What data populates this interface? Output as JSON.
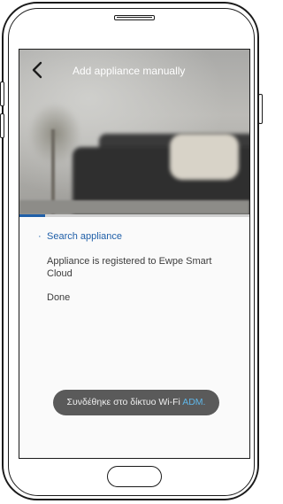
{
  "header": {
    "title": "Add appliance manually",
    "back_icon": "chevron-left-icon"
  },
  "progress": {
    "fraction": 0.11
  },
  "steps": [
    {
      "label": "Search appliance",
      "state": "active",
      "marker": "·"
    },
    {
      "label": "Appliance is registered to Ewpe Smart Cloud",
      "state": "pending"
    },
    {
      "label": "Done",
      "state": "pending"
    }
  ],
  "toast": {
    "text": "Συνδέθηκε στο δίκτυο Wi-Fi ",
    "ssid": "ADM."
  },
  "colors": {
    "accent": "#1f5fa8",
    "toast_bg": "#5a5a5a",
    "ssid": "#5fb6e8"
  }
}
